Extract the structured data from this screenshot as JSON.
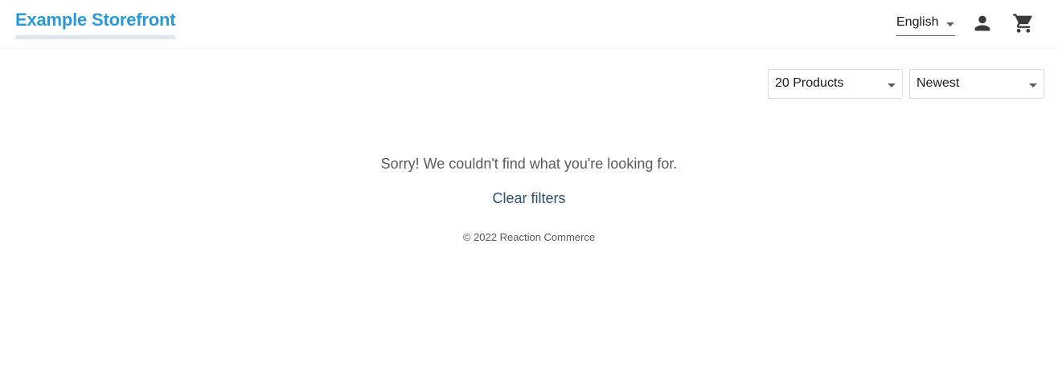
{
  "header": {
    "logo_text": "Example Storefront",
    "language": {
      "selected": "English"
    },
    "account_icon": "person-icon",
    "cart_icon": "shopping-cart-icon"
  },
  "toolbar": {
    "page_size": {
      "selected": "20 Products"
    },
    "sort_by": {
      "selected": "Newest"
    }
  },
  "empty_state": {
    "message": "Sorry! We couldn't find what you're looking for.",
    "clear_filters_label": "Clear filters"
  },
  "footer": {
    "copyright": "© 2022 Reaction Commerce"
  },
  "colors": {
    "brand": "#2a9ad6",
    "link": "#2c4f66",
    "text": "#595959"
  }
}
